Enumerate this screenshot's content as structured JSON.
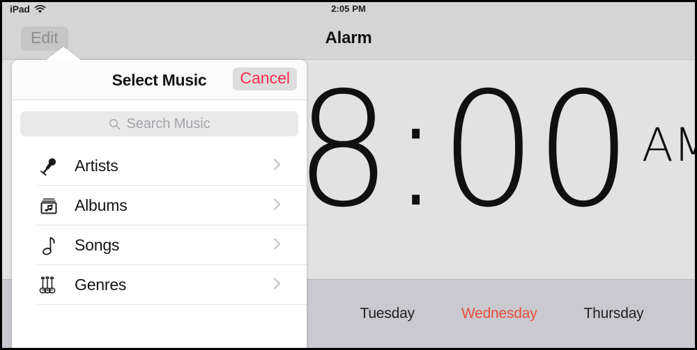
{
  "status_bar": {
    "device": "iPad",
    "wifi_icon": "wifi-icon",
    "time": "2:05 PM"
  },
  "nav_bar": {
    "edit_label": "Edit",
    "title": "Alarm"
  },
  "alarm": {
    "time": "8:00",
    "meridiem": "AM",
    "days": [
      {
        "label": "Tuesday",
        "selected": false
      },
      {
        "label": "Wednesday",
        "selected": true
      },
      {
        "label": "Thursday",
        "selected": false
      }
    ]
  },
  "popover": {
    "title": "Select Music",
    "cancel_label": "Cancel",
    "search": {
      "icon": "search-icon",
      "placeholder": "Search Music",
      "value": ""
    },
    "items": [
      {
        "label": "Artists",
        "icon": "microphone-icon",
        "chevron": "chevron-right-icon"
      },
      {
        "label": "Albums",
        "icon": "album-stack-icon",
        "chevron": "chevron-right-icon"
      },
      {
        "label": "Songs",
        "icon": "music-note-icon",
        "chevron": "chevron-right-icon"
      },
      {
        "label": "Genres",
        "icon": "guitars-icon",
        "chevron": "chevron-right-icon"
      }
    ]
  },
  "colors": {
    "accent_cancel": "#fb2d4f",
    "accent_selected_day": "#e8503a",
    "nav_background": "#d5d5d5",
    "content_background": "#e2e2e2",
    "day_picker_background": "#c9c9cf",
    "popover_background": "#ffffff"
  }
}
